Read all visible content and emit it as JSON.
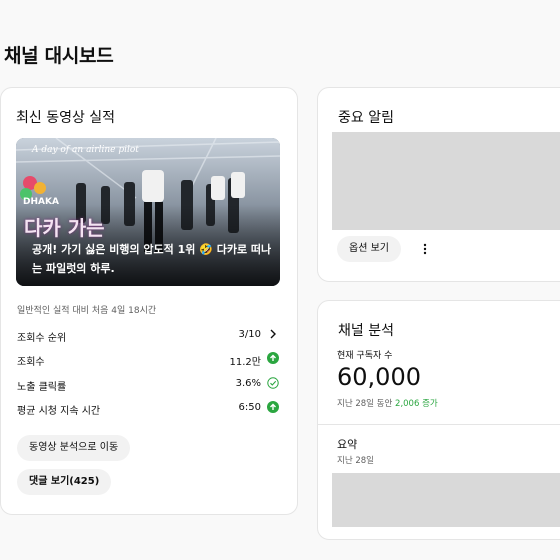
{
  "page": {
    "title": "채널 대시보드"
  },
  "latest_video": {
    "title": "최신 동영상 실적",
    "thumbnail": {
      "script_text": "A day of an airline pilot",
      "tag": "DHAKA",
      "big_text": "다카 가는",
      "caption": "공개! 가기 싫은 비행의 압도적 1위 🤣 다카로 떠나는 파일럿의 하루."
    },
    "compare_note": "일반적인 실적 대비 처음 4일 18시간",
    "metrics": [
      {
        "label": "조회수 순위",
        "value": "3/10",
        "icon": "chevron-right-icon"
      },
      {
        "label": "조회수",
        "value": "11.2만",
        "icon": "arrow-up-green-icon"
      },
      {
        "label": "노출 클릭률",
        "value": "3.6%",
        "icon": "check-circle-icon"
      },
      {
        "label": "평균 시청 지속 시간",
        "value": "6:50",
        "icon": "arrow-up-green-icon"
      }
    ],
    "buttons": {
      "analytics": "동영상 분석으로 이동",
      "comments": "댓글 보기(425)"
    }
  },
  "alerts": {
    "title": "중요 알림",
    "options_button": "옵션 보기"
  },
  "channel_analytics": {
    "title": "채널 분석",
    "subscribers_label": "현재 구독자 수",
    "subscribers_value": "60,000",
    "change_prefix": "지난 28일 동안",
    "change_value": "2,006 증가",
    "summary_title": "요약",
    "summary_period": "지난 28일"
  },
  "colors": {
    "green": "#2ba640",
    "accent_text": "#0f0f0f",
    "muted": "#606060"
  }
}
